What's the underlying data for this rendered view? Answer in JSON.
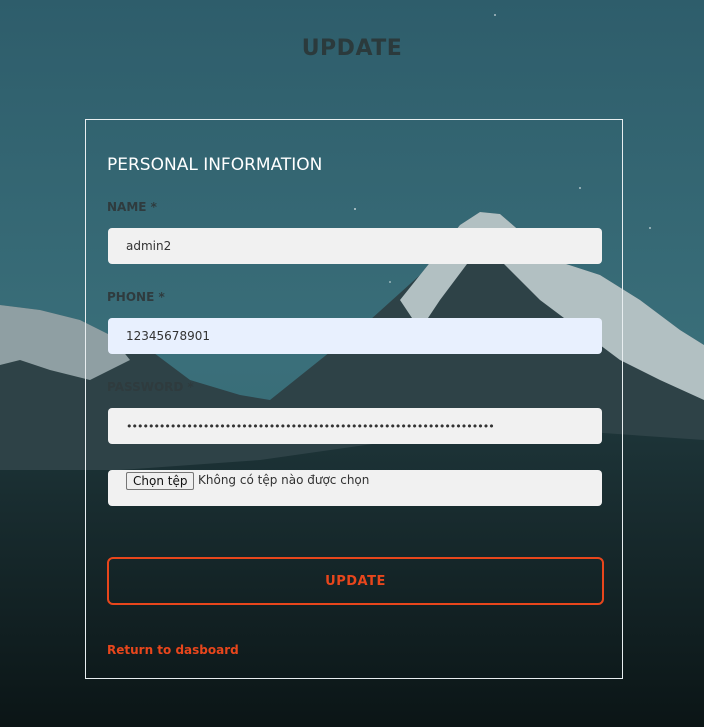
{
  "page": {
    "title": "UPDATE"
  },
  "form": {
    "section_title": "PERSONAL INFORMATION",
    "name": {
      "label": "NAME *",
      "value": "admin2"
    },
    "phone": {
      "label": "PHONE *",
      "value": "12345678901"
    },
    "password": {
      "label": "PASSWORD *",
      "value": "•••••••••••••••••••••••••••••••••••••••••••••••••••••••••••••••••••"
    },
    "file": {
      "button_label": "Chọn tệp",
      "status_text": "Không có tệp nào được chọn"
    },
    "submit_label": "UPDATE",
    "return_link": "Return to dasboard"
  },
  "colors": {
    "accent": "#e8461c",
    "card_border": "#e8eef0"
  }
}
